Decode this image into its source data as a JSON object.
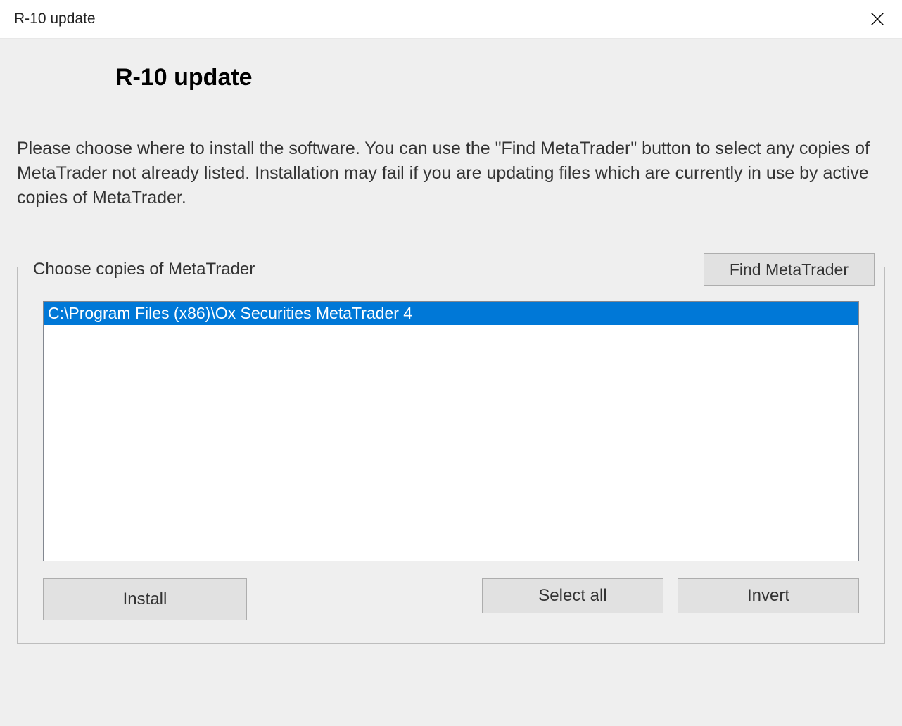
{
  "window": {
    "title": "R-10 update"
  },
  "header": {
    "heading": "R-10 update"
  },
  "description": "Please choose where to install the software. You can use the \"Find MetaTrader\" button to select any copies of MetaTrader not already listed. Installation may fail if you are updating files which are currently in use by active copies of MetaTrader.",
  "fieldset": {
    "legend": "Choose copies of MetaTrader",
    "find_label": "Find MetaTrader",
    "items": [
      {
        "path": "C:\\Program Files (x86)\\Ox Securities MetaTrader 4",
        "selected": true
      }
    ]
  },
  "buttons": {
    "install": "Install",
    "select_all": "Select all",
    "invert": "Invert"
  }
}
